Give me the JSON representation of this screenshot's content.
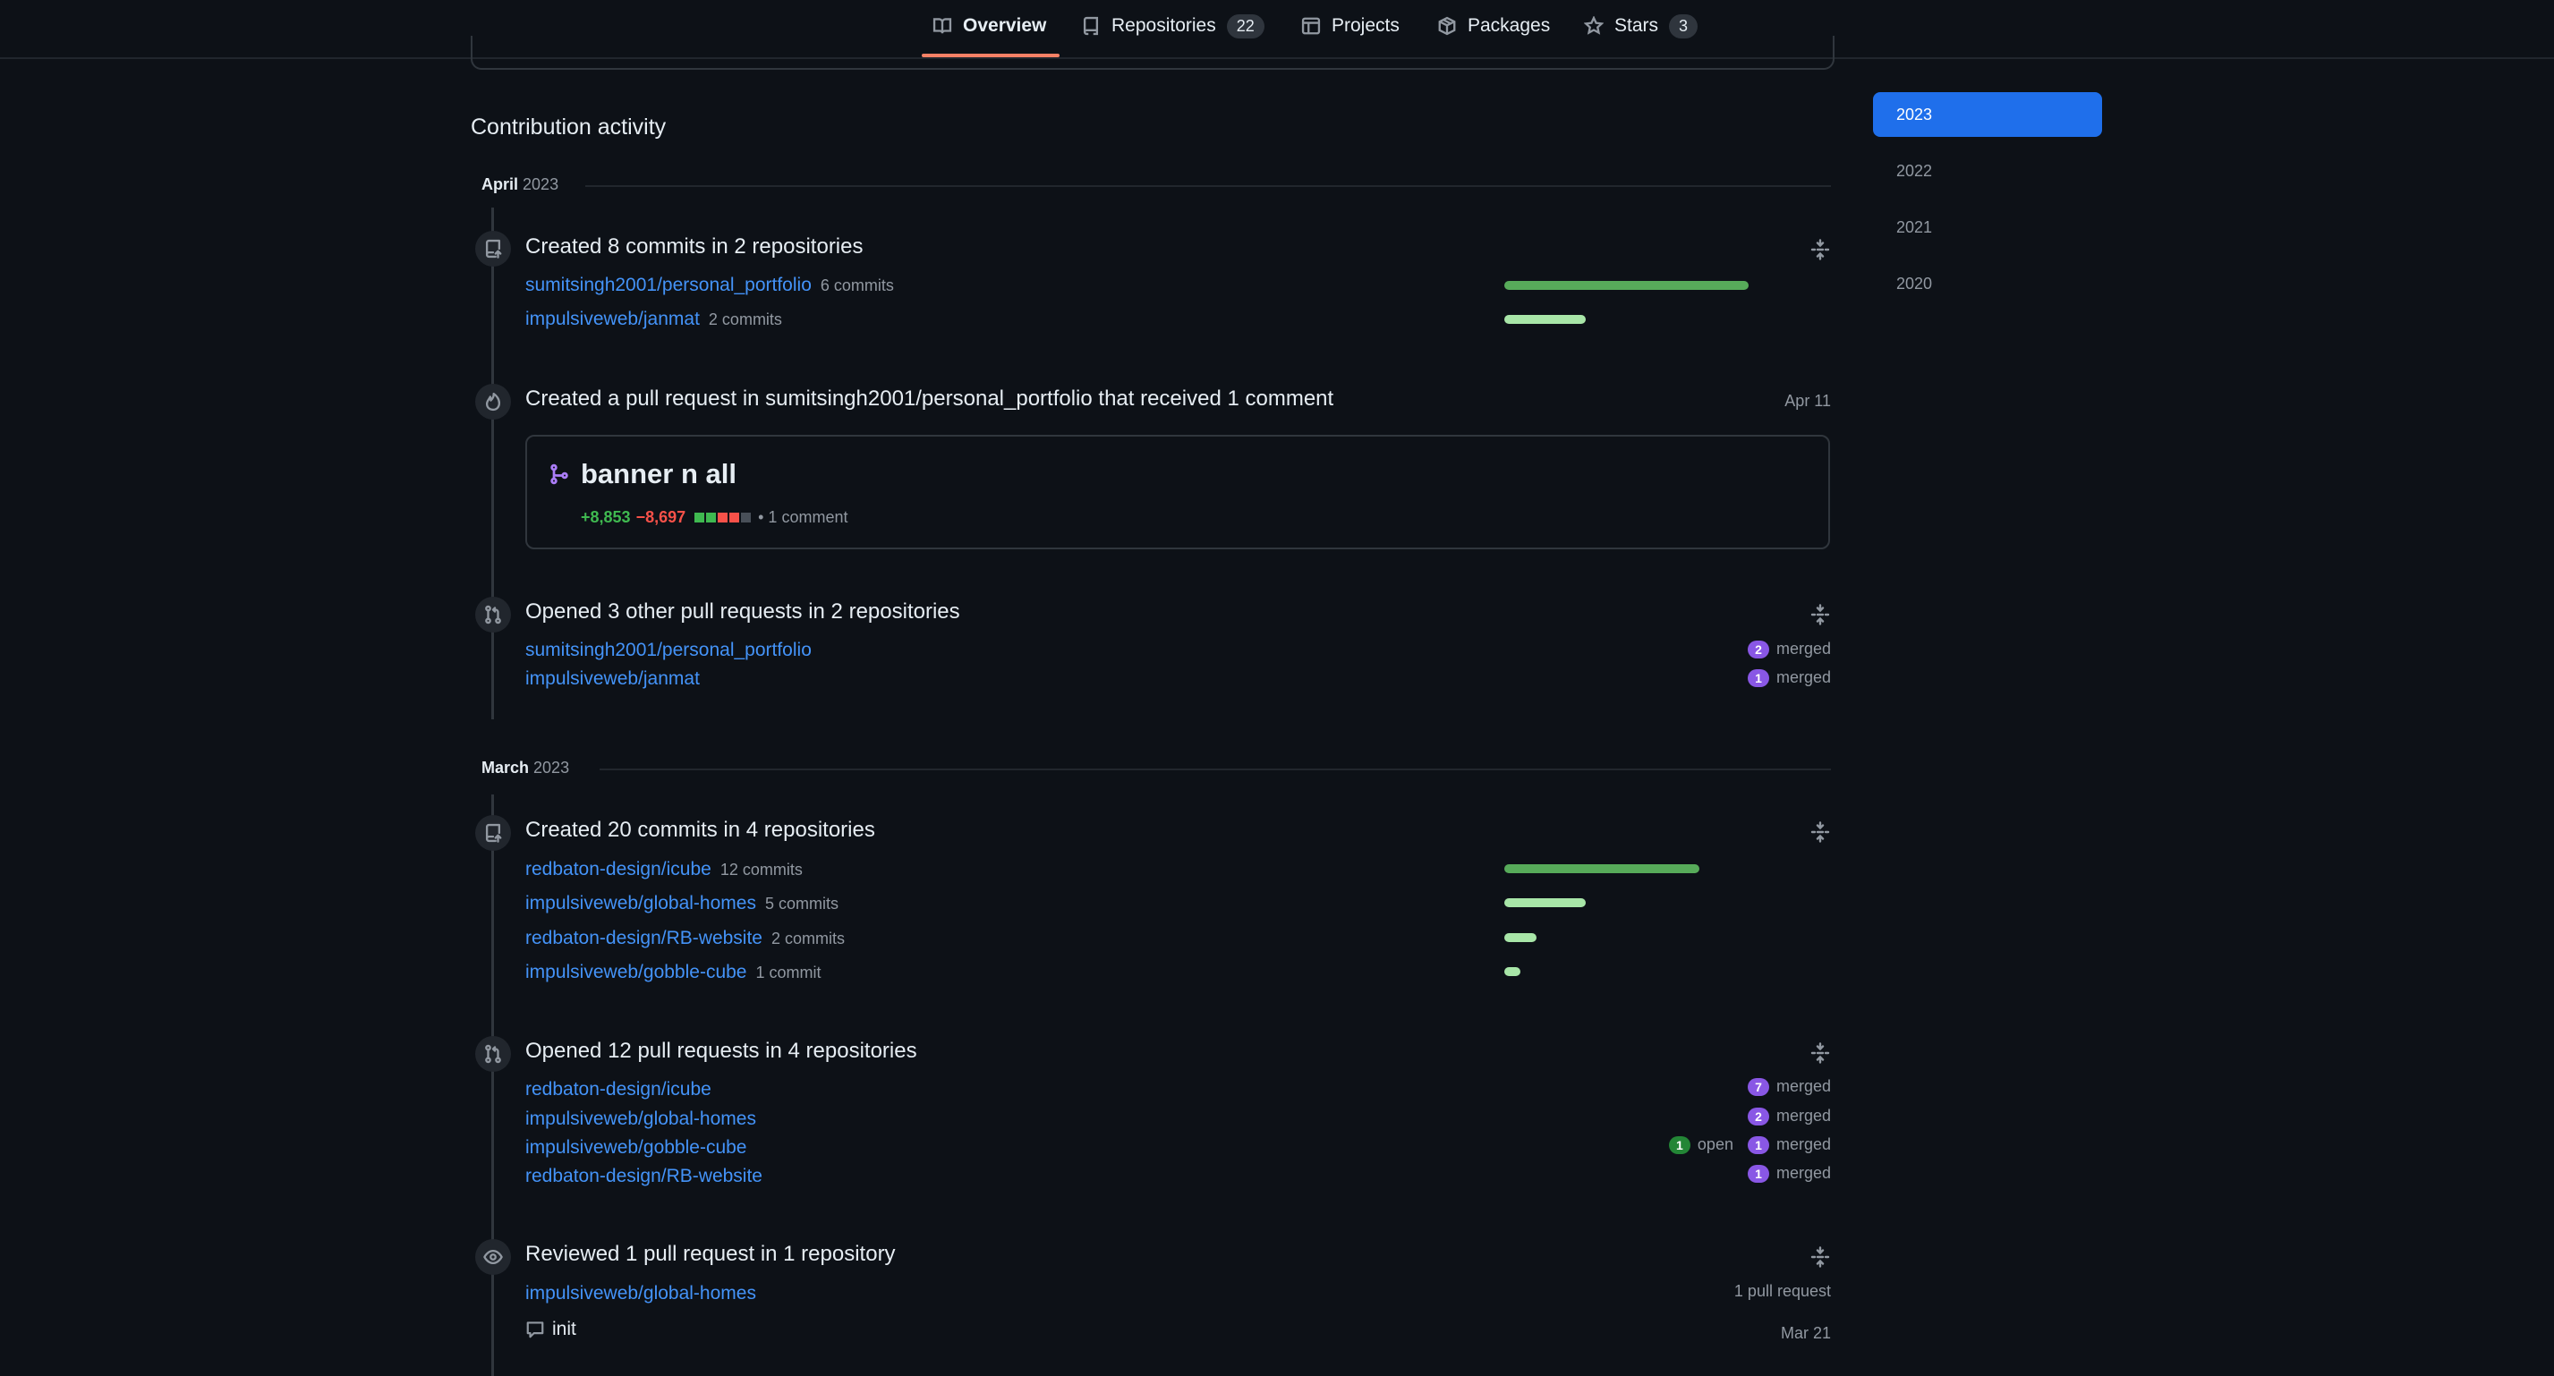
{
  "nav": {
    "tabs": [
      {
        "label": "Overview",
        "icon": "book-icon",
        "count": null
      },
      {
        "label": "Repositories",
        "icon": "repo-icon",
        "count": "22"
      },
      {
        "label": "Projects",
        "icon": "table-icon",
        "count": null
      },
      {
        "label": "Packages",
        "icon": "package-icon",
        "count": null
      },
      {
        "label": "Stars",
        "icon": "star-icon",
        "count": "3"
      }
    ]
  },
  "section_title": "Contribution activity",
  "months": [
    {
      "month": "April",
      "year": "2023"
    },
    {
      "month": "March",
      "year": "2023"
    }
  ],
  "april": {
    "commits": {
      "title": "Created 8 commits in 2 repositories",
      "repos": [
        {
          "name": "sumitsingh2001/personal_portfolio",
          "count": "6 commits",
          "share": 0.75
        },
        {
          "name": "impulsiveweb/janmat",
          "count": "2 commits",
          "share": 0.25
        }
      ]
    },
    "pr_created": {
      "title": "Created a pull request in sumitsingh2001/personal_portfolio that received 1 comment",
      "date": "Apr 11",
      "pr_title": "banner n all",
      "additions": "+8,853",
      "deletions": "−8,697",
      "comments": "• 1 comment"
    },
    "prs_opened": {
      "title": "Opened 3 other pull requests in 2 repositories",
      "repos": [
        {
          "name": "sumitsingh2001/personal_portfolio",
          "merged": "2",
          "merged_label": "merged"
        },
        {
          "name": "impulsiveweb/janmat",
          "merged": "1",
          "merged_label": "merged"
        }
      ]
    }
  },
  "march": {
    "commits": {
      "title": "Created 20 commits in 4 repositories",
      "repos": [
        {
          "name": "redbaton-design/icube",
          "count": "12 commits",
          "share": 0.6
        },
        {
          "name": "impulsiveweb/global-homes",
          "count": "5 commits",
          "share": 0.25
        },
        {
          "name": "redbaton-design/RB-website",
          "count": "2 commits",
          "share": 0.1
        },
        {
          "name": "impulsiveweb/gobble-cube",
          "count": "1 commit",
          "share": 0.05
        }
      ]
    },
    "prs_opened": {
      "title": "Opened 12 pull requests in 4 repositories",
      "repos": [
        {
          "name": "redbaton-design/icube",
          "merged": "7",
          "merged_label": "merged"
        },
        {
          "name": "impulsiveweb/global-homes",
          "merged": "2",
          "merged_label": "merged"
        },
        {
          "name": "impulsiveweb/gobble-cube",
          "open": "1",
          "open_label": "open",
          "merged": "1",
          "merged_label": "merged"
        },
        {
          "name": "redbaton-design/RB-website",
          "merged": "1",
          "merged_label": "merged"
        }
      ]
    },
    "reviewed": {
      "title": "Reviewed 1 pull request in 1 repository",
      "repo": "impulsiveweb/global-homes",
      "count": "1 pull request",
      "pr": "init",
      "date": "Mar 21"
    }
  },
  "years": [
    "2023",
    "2022",
    "2021",
    "2020"
  ],
  "colors": {
    "background": "#0d1117",
    "link": "#4493f8",
    "selected_year": "#1f6feb",
    "merged": "#8957e5",
    "open": "#238636",
    "commit_bar_dark": "#57ab5a",
    "commit_bar_light": "#a8e6a8"
  }
}
